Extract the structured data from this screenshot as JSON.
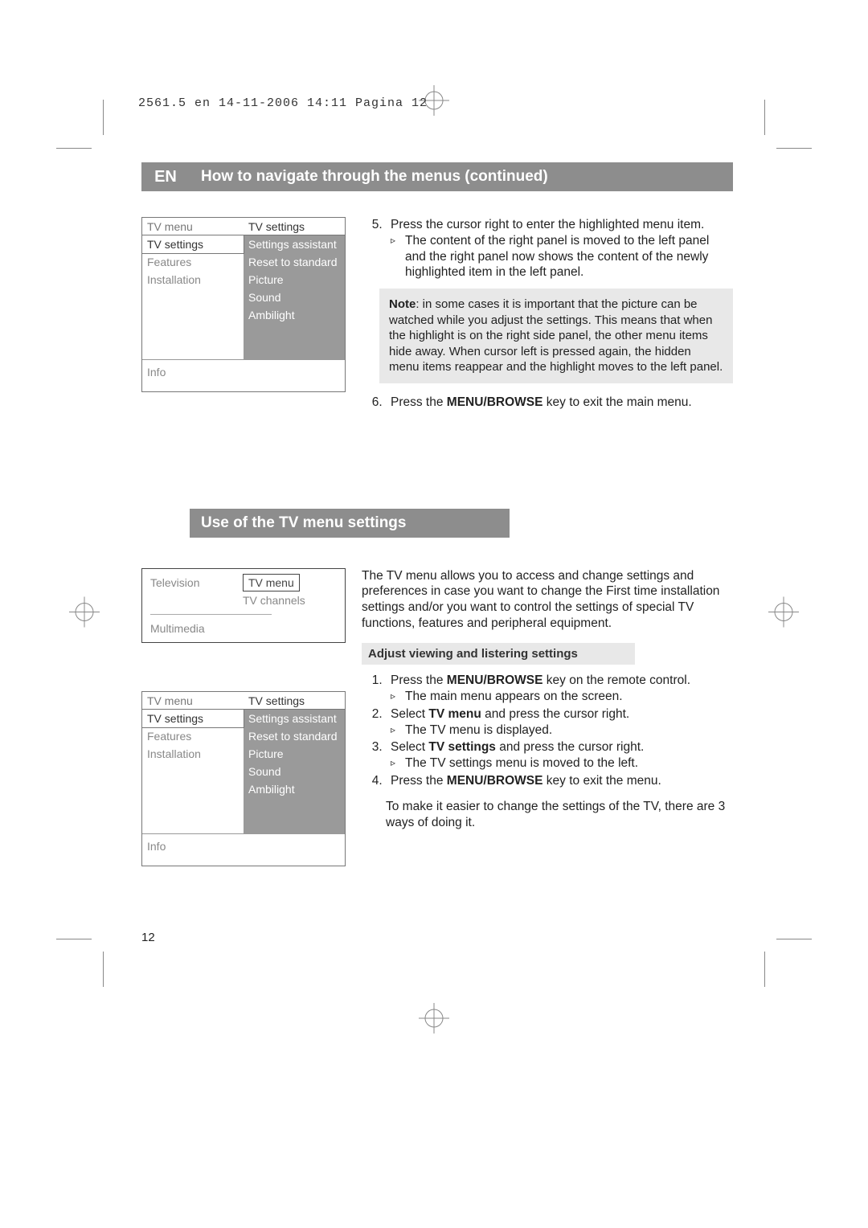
{
  "header_line": "2561.5 en  14-11-2006  14:11  Pagina 12",
  "lang_badge": "EN",
  "title1": "How to navigate through the menus  (continued)",
  "title2": "Use of the TV menu settings",
  "page_number": "12",
  "menu1": {
    "left_title": "TV menu",
    "left_items": [
      "TV settings",
      "Features",
      "Installation"
    ],
    "right_title": "TV settings",
    "right_items": [
      "Settings assistant",
      "Reset to standard",
      "Picture",
      "Sound",
      "Ambilight"
    ],
    "info": "Info"
  },
  "step5": {
    "num": "5.",
    "text": "Press the cursor right to enter the highlighted menu item.",
    "sub": "The content of the right panel is moved to the left panel and the right panel now shows the content of the newly highlighted item in the left panel."
  },
  "note": {
    "label": "Note",
    "text": ": in some cases it is important that the picture can be watched while you adjust the settings. This means that when the highlight is on the right side panel, the other menu items hide away. When cursor left is pressed again, the hidden menu items reappear and the highlight moves to the left panel."
  },
  "step6": {
    "num": "6.",
    "pre": "Press the ",
    "bold": "MENU/BROWSE",
    "post": " key to exit the main menu."
  },
  "menu2": {
    "left1": "Television",
    "right_sel": "TV menu",
    "right_item": "TV channels",
    "left2": "Multimedia"
  },
  "menu3": {
    "left_title": "TV menu",
    "left_items": [
      "TV settings",
      "Features",
      "Installation"
    ],
    "right_title": "TV settings",
    "right_items": [
      "Settings assistant",
      "Reset to standard",
      "Picture",
      "Sound",
      "Ambilight"
    ],
    "info": "Info"
  },
  "intro2": "The TV menu allows you to access and change settings and preferences in case you want to change the First time installation settings and/or you want to control the settings of special TV functions, features and peripheral equipment.",
  "subhead": "Adjust viewing and listering settings",
  "s1": {
    "pre": "Press the ",
    "b": "MENU/BROWSE",
    "post": " key on the remote control.",
    "sub": "The main menu appears on the screen."
  },
  "s2": {
    "pre": "Select ",
    "b": "TV menu",
    "post": " and press the cursor right.",
    "sub": "The TV menu is displayed."
  },
  "s3": {
    "pre": "Select ",
    "b": "TV settings",
    "post": " and press the cursor right.",
    "sub": "The TV settings menu is moved to the left."
  },
  "s4": {
    "pre": "Press the ",
    "b": "MENU/BROWSE",
    "post": " key to exit the menu."
  },
  "closing": "To make it easier to change the settings of the TV, there are 3 ways of doing it."
}
